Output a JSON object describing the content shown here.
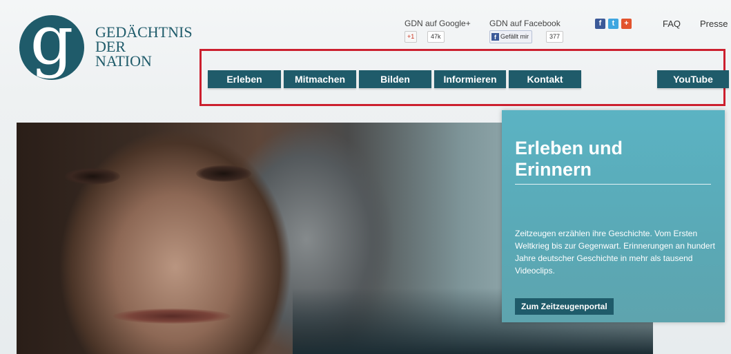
{
  "logo": {
    "glyph": "g",
    "lines": [
      "GEDÄCHTNIS",
      "DER",
      "NATION"
    ]
  },
  "social": {
    "google_label": "GDN auf Google+",
    "google_badge": "+1",
    "google_count": "47k",
    "facebook_label": "GDN auf Facebook",
    "facebook_like": "Gefällt mir",
    "facebook_count": "377",
    "share_icons": [
      {
        "name": "facebook-icon",
        "glyph": "f",
        "color": "#3b5998"
      },
      {
        "name": "twitter-icon",
        "glyph": "t",
        "color": "#3fa6e0"
      },
      {
        "name": "google-plus-icon",
        "glyph": "+",
        "color": "#e2532d"
      }
    ]
  },
  "toplinks": {
    "faq": "FAQ",
    "presse": "Presse"
  },
  "nav": {
    "tabs": [
      "Erleben",
      "Mitmachen",
      "Bilden",
      "Informieren",
      "Kontakt"
    ],
    "youtube": "YouTube"
  },
  "teaser": {
    "title_line1": "Erleben und",
    "title_line2": "Erinnern",
    "text": "Zeitzeugen erzählen ihre Geschichte. Vom Ersten Weltkrieg bis zur Gegenwart. Erinnerungen an hundert Jahre deutscher Geschichte in mehr als tausend Videoclips.",
    "button": "Zum Zeitzeugenportal"
  },
  "colors": {
    "brand": "#1f5b6a",
    "teaser": "#5bb3c3",
    "highlight": "#cc1f2e"
  }
}
